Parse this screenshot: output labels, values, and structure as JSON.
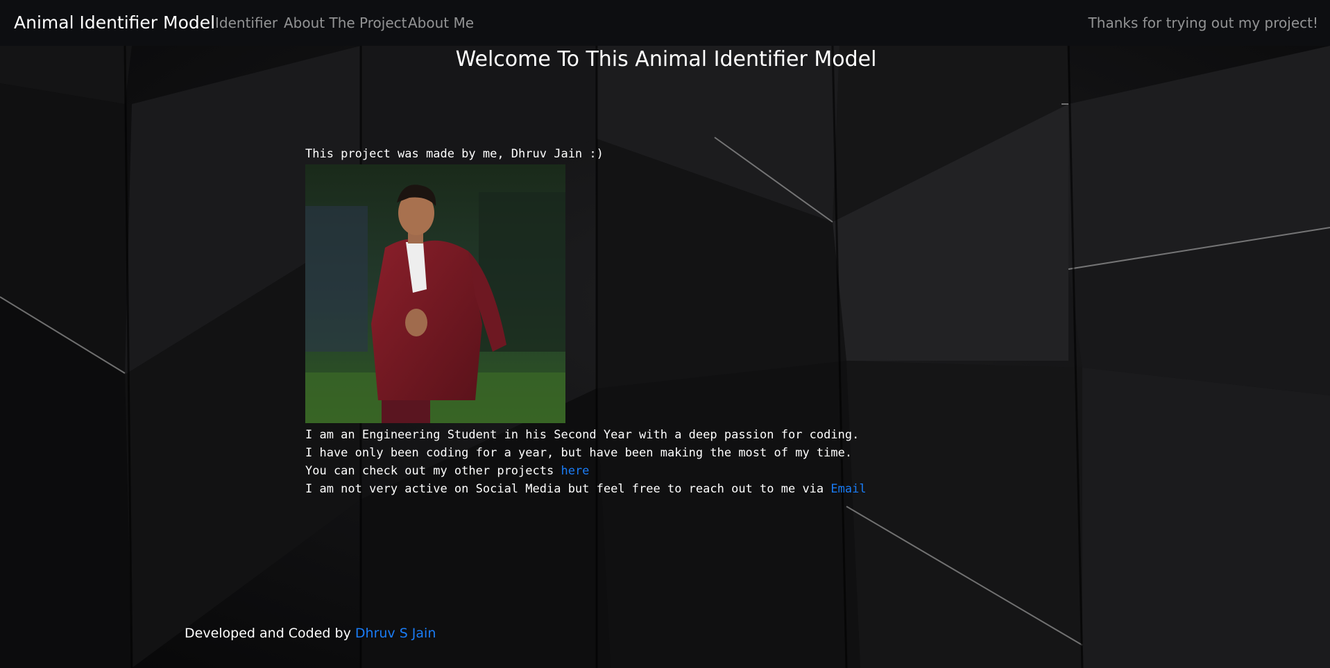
{
  "navbar": {
    "brand": "Animal Identifier Model",
    "links": [
      {
        "label": "Identifier"
      },
      {
        "label": "About The Project"
      },
      {
        "label": "About Me"
      }
    ],
    "right_text": "Thanks for trying out my project!"
  },
  "main": {
    "title": "Welcome To This Animal Identifier Model",
    "intro": "This project was made by me, Dhruv Jain :)",
    "bio_line1": "I am an Engineering Student in his Second Year with a deep passion for coding.",
    "bio_line2": "I have only been coding for a year, but have been making the most of my time.",
    "projects_text": "You can check out my other projects ",
    "projects_link": "here",
    "social_text": "I am not very active on Social Media but feel free to reach out to me via ",
    "email_link": "Email"
  },
  "footer": {
    "text": "Developed and Coded by ",
    "author_link": "Dhruv S Jain"
  },
  "colors": {
    "link": "#1a7cf5",
    "navbar_bg": "#0d0e11",
    "jacket": "#7a1a24"
  }
}
